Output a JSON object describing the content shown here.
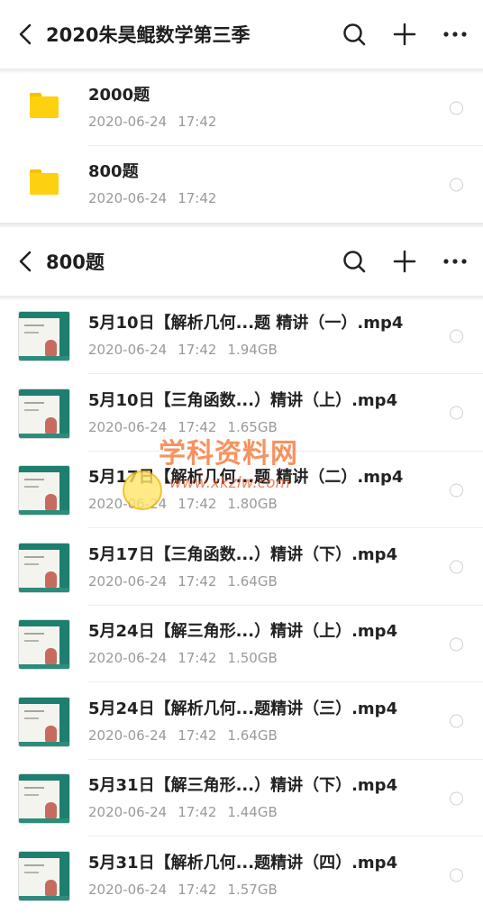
{
  "header1": {
    "title": "2020朱昊鲲数学第三季"
  },
  "folders": [
    {
      "name": "2000题",
      "date": "2020-06-24",
      "time": "17:42"
    },
    {
      "name": "800题",
      "date": "2020-06-24",
      "time": "17:42"
    }
  ],
  "header2": {
    "title": "800题"
  },
  "files": [
    {
      "name": "5月10日【解析几何...题 精讲（一）.mp4",
      "date": "2020-06-24",
      "time": "17:42",
      "size": "1.94GB"
    },
    {
      "name": "5月10日【三角函数...）精讲（上）.mp4",
      "date": "2020-06-24",
      "time": "17:42",
      "size": "1.65GB"
    },
    {
      "name": "5月17日【解析几何...题 精讲（二）.mp4",
      "date": "2020-06-24",
      "time": "17:42",
      "size": "1.80GB"
    },
    {
      "name": "5月17日【三角函数...）精讲（下）.mp4",
      "date": "2020-06-24",
      "time": "17:42",
      "size": "1.64GB"
    },
    {
      "name": "5月24日【解三角形...）精讲（上）.mp4",
      "date": "2020-06-24",
      "time": "17:42",
      "size": "1.50GB"
    },
    {
      "name": "5月24日【解析几何...题精讲（三）.mp4",
      "date": "2020-06-24",
      "time": "17:42",
      "size": "1.64GB"
    },
    {
      "name": "5月31日【解三角形...）精讲（下）.mp4",
      "date": "2020-06-24",
      "time": "17:42",
      "size": "1.44GB"
    },
    {
      "name": "5月31日【解析几何...题精讲（四）.mp4",
      "date": "2020-06-24",
      "time": "17:42",
      "size": "1.57GB"
    }
  ],
  "watermark": {
    "text": "学科资料网",
    "url": "www.xkzlw.com"
  },
  "colors": {
    "folder": "#fdd10f",
    "thumb_accent": "#1f7f6e",
    "meta_text": "#9a9a9a"
  }
}
